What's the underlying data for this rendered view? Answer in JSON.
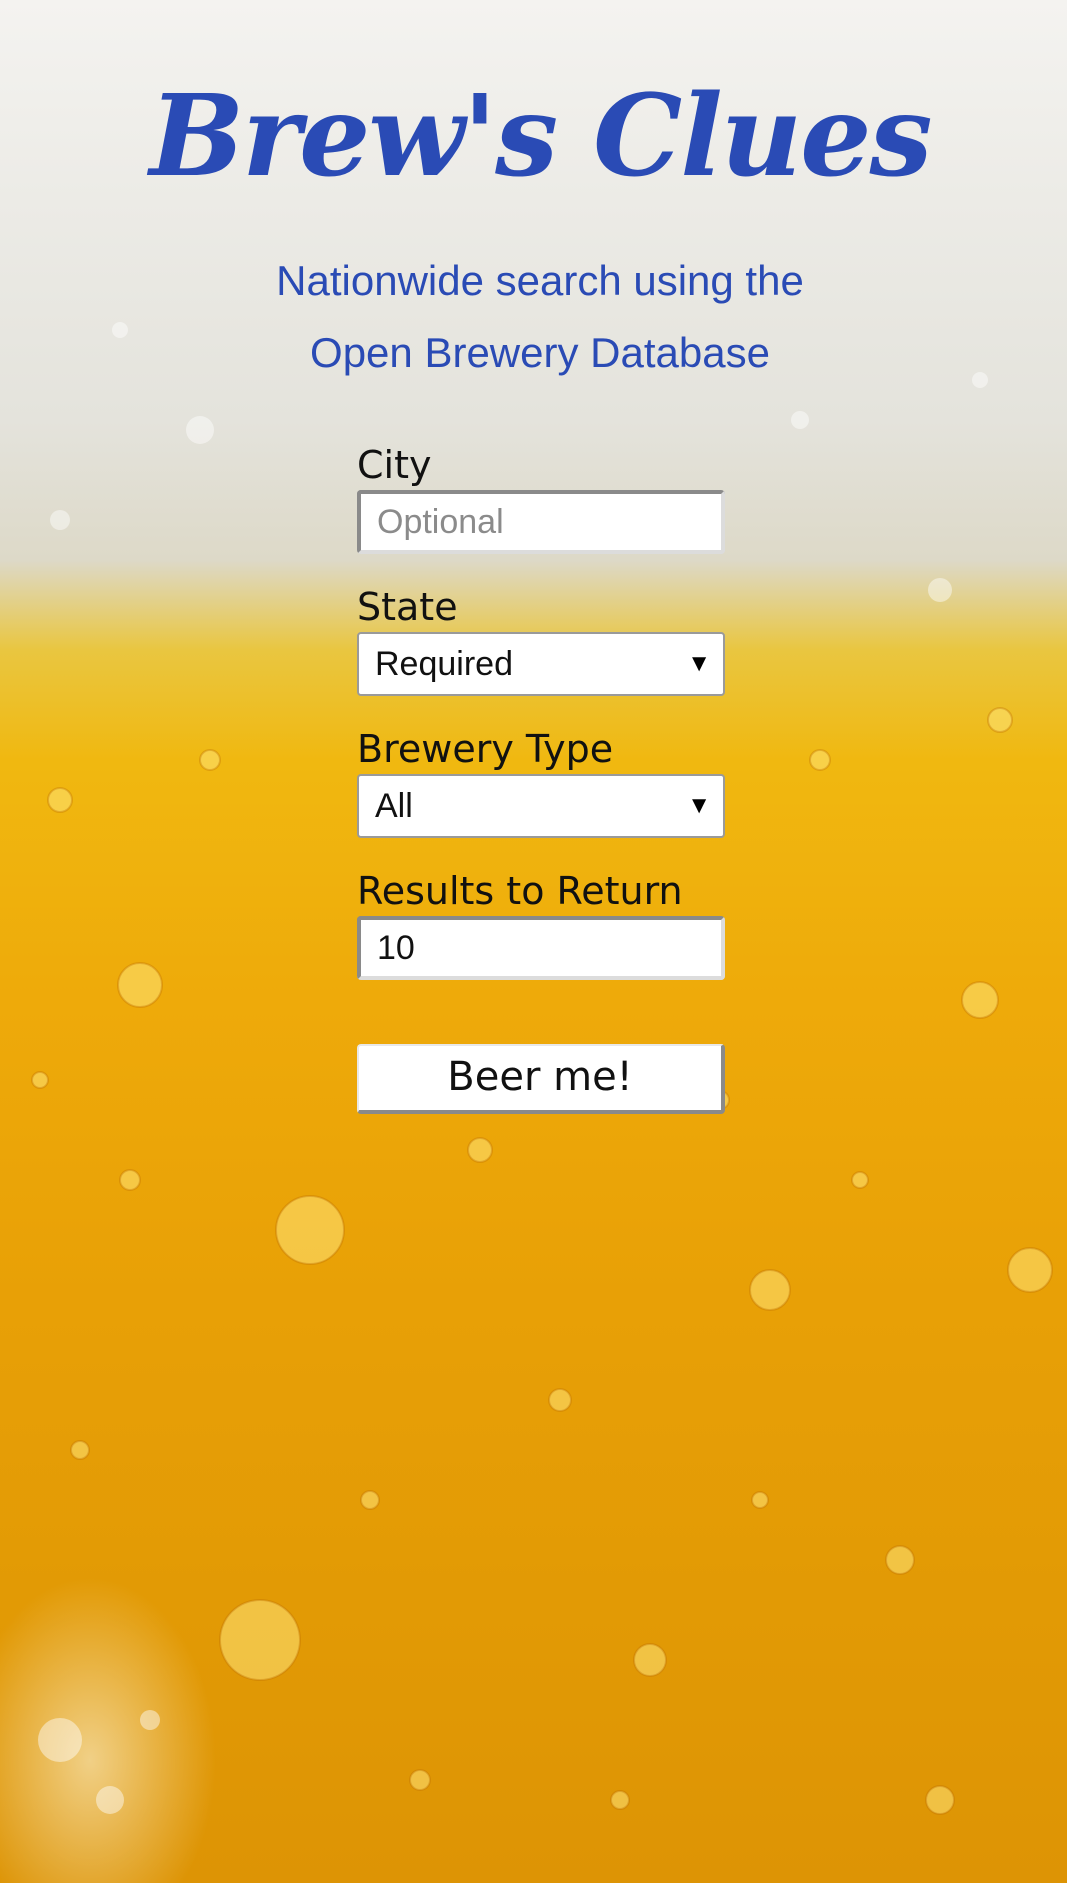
{
  "header": {
    "title": "Brew's Clues",
    "subtitle_line1": "Nationwide search using the",
    "subtitle_line2": "Open Brewery Database"
  },
  "form": {
    "city": {
      "label": "City",
      "placeholder": "Optional",
      "value": ""
    },
    "state": {
      "label": "State",
      "selected": "Required"
    },
    "brewery_type": {
      "label": "Brewery Type",
      "selected": "All"
    },
    "results": {
      "label": "Results to Return",
      "value": "10"
    },
    "submit_label": "Beer me!"
  },
  "colors": {
    "title_blue": "#2a4bb5",
    "beer_amber": "#eeaa0a",
    "foam": "#ecebe6"
  },
  "icons": {
    "select_arrow": "dropdown-arrow-icon"
  }
}
